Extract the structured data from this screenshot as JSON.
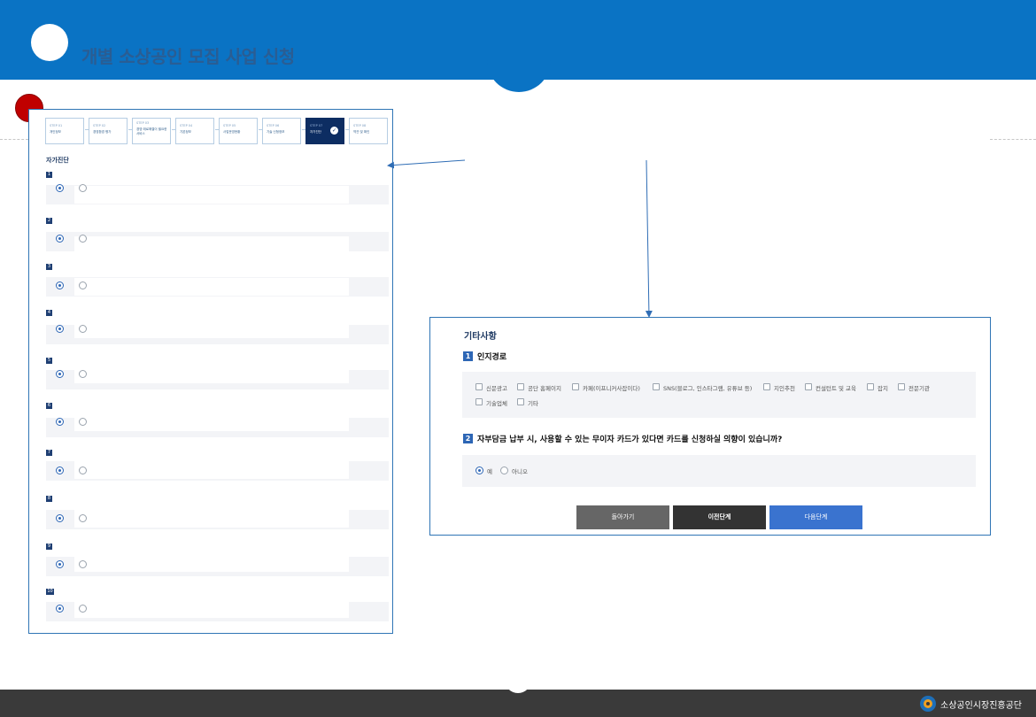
{
  "header": {
    "title": "개별 소상공인 모집 사업 신청"
  },
  "left_panel": {
    "steps": [
      {
        "no": "STEP 01",
        "name": "개인정보"
      },
      {
        "no": "STEP 02",
        "name": "경영환경 평가"
      },
      {
        "no": "STEP 03",
        "name": "경영 애로해결이 필요한 서비스"
      },
      {
        "no": "STEP 04",
        "name": "기본정보"
      },
      {
        "no": "STEP 05",
        "name": "사업운영현황"
      },
      {
        "no": "STEP 06",
        "name": "기술 신청정보"
      },
      {
        "no": "STEP 07",
        "name": "자가진단",
        "active": true
      },
      {
        "no": "STEP 08",
        "name": "약관 및 확인"
      }
    ],
    "title": "자가진단",
    "questions": [
      "1",
      "2",
      "3",
      "4",
      "5",
      "6",
      "7",
      "8",
      "9",
      "10"
    ]
  },
  "right_panel": {
    "title": "기타사항",
    "q1": {
      "no": "1",
      "text": "인지경로",
      "options": [
        "신문광고",
        "공단 홈페이지",
        "카페(이프니커사잡이다)",
        "SNS(블로그, 인스타그램, 유튜브 등)",
        "지인추천",
        "컨설턴트 및 교육",
        "잡지",
        "전문기관",
        "기술업체",
        "기타"
      ]
    },
    "q2": {
      "no": "2",
      "text": "자부담금 납부 시, 사용할 수 있는 무이자 카드가 있다면 카드를 신청하실 의향이 있습니까?",
      "options": [
        "예",
        "아니오"
      ],
      "selected": "예"
    },
    "buttons": {
      "back": "돌아가기",
      "prev": "이전단계",
      "next": "다음단계"
    }
  },
  "footer": {
    "org": "소상공인시장진흥공단"
  },
  "colors": {
    "brand_blue": "#0a73c4",
    "accent": "#2d66b5",
    "marker_red": "#c00000",
    "footer_bg": "#3a3a3a"
  }
}
